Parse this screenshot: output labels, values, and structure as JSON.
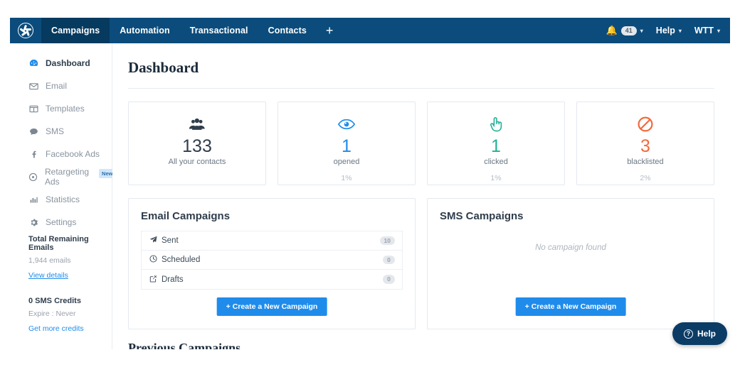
{
  "topnav": {
    "logo_name": "brand-logo",
    "items": [
      {
        "label": "Campaigns",
        "active": true
      },
      {
        "label": "Automation",
        "active": false
      },
      {
        "label": "Transactional",
        "active": false
      },
      {
        "label": "Contacts",
        "active": false
      }
    ],
    "add_label": "+",
    "notifications": {
      "count": "41"
    },
    "help_label": "Help",
    "account_label": "WTT",
    "caret": "▾"
  },
  "sidebar": {
    "items": [
      {
        "label": "Dashboard",
        "icon": "dashboard-icon",
        "glyph": "◉",
        "active": true,
        "badge": ""
      },
      {
        "label": "Email",
        "icon": "envelope-icon",
        "glyph": "✉",
        "active": false,
        "badge": ""
      },
      {
        "label": "Templates",
        "icon": "templates-icon",
        "glyph": "❏",
        "active": false,
        "badge": ""
      },
      {
        "label": "SMS",
        "icon": "chat-bubble-icon",
        "glyph": "💬",
        "active": false,
        "badge": ""
      },
      {
        "label": "Facebook Ads",
        "icon": "facebook-icon",
        "glyph": "f",
        "active": false,
        "badge": ""
      },
      {
        "label": "Retargeting Ads",
        "icon": "target-icon",
        "glyph": "◎",
        "active": false,
        "badge": "New"
      },
      {
        "label": "Statistics",
        "icon": "bar-chart-icon",
        "glyph": "▥",
        "active": false,
        "badge": ""
      },
      {
        "label": "Settings",
        "icon": "gear-icon",
        "glyph": "✾",
        "active": false,
        "badge": ""
      }
    ],
    "footer": {
      "emails_title": "Total Remaining Emails",
      "emails_value": "1,944 emails",
      "emails_link": "View details",
      "sms_title": "0 SMS Credits",
      "sms_expire": "Expire : Never",
      "sms_link": "Get more credits"
    }
  },
  "main": {
    "page_title": "Dashboard",
    "cards": [
      {
        "icon": "users-icon",
        "value": "133",
        "label": "All your contacts",
        "pct": "",
        "color": "#2f3d4c"
      },
      {
        "icon": "eye-icon",
        "value": "1",
        "label": "opened",
        "pct": "1%",
        "color": "#1f8ceb"
      },
      {
        "icon": "pointing-hand-icon",
        "value": "1",
        "label": "clicked",
        "pct": "1%",
        "color": "#22b196"
      },
      {
        "icon": "blocked-icon",
        "value": "3",
        "label": "blacklisted",
        "pct": "2%",
        "color": "#f2693c"
      }
    ],
    "email_panel": {
      "title": "Email Campaigns",
      "rows": [
        {
          "label": "Sent",
          "icon": "paper-plane-icon",
          "glyph": "➤",
          "count": "10"
        },
        {
          "label": "Scheduled",
          "icon": "clock-icon",
          "glyph": "◷",
          "count": "0"
        },
        {
          "label": "Drafts",
          "icon": "edit-square-icon",
          "glyph": "✎",
          "count": "0"
        }
      ],
      "button_label": "Create a New Campaign"
    },
    "sms_panel": {
      "title": "SMS Campaigns",
      "empty_message": "No campaign found",
      "button_label": "Create a New Campaign"
    },
    "next_section_title": "Previous Campaigns"
  },
  "help_widget": {
    "label": "Help",
    "icon_char": "?"
  }
}
